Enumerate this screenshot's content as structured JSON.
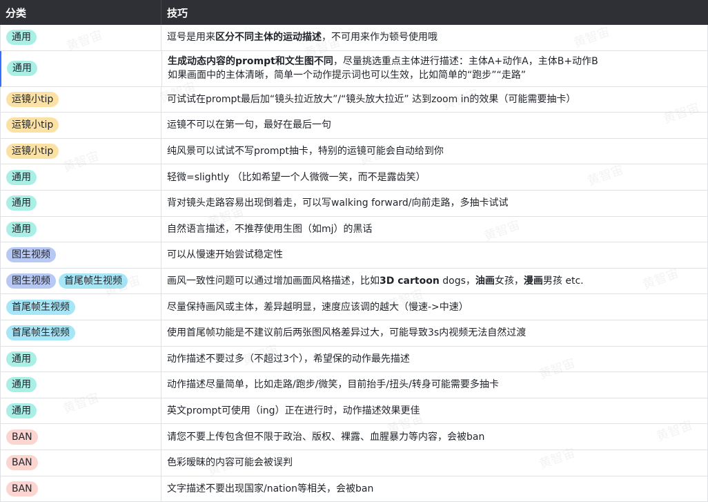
{
  "header": {
    "col_category": "分类",
    "col_tip": "技巧"
  },
  "watermark": "黄智宙",
  "colors": {
    "header_bg": "#2e3035",
    "tag_general": "#a9efe6",
    "tag_camera": "#fbe2a4",
    "tag_img2vid": "#b8c8f5",
    "tag_firstlast": "#a7e6f6",
    "tag_ban": "#fcd4d0"
  },
  "rows": [
    {
      "tags": [
        {
          "label": "通用",
          "kind": "general"
        }
      ],
      "lines": [
        [
          {
            "t": "逗号是用来"
          },
          {
            "t": "区分不同主体的运动描述",
            "b": true
          },
          {
            "t": "，不可用来作为顿号使用哦"
          }
        ]
      ]
    },
    {
      "tall": true,
      "tags": [
        {
          "label": "通用",
          "kind": "general"
        }
      ],
      "lines": [
        [
          {
            "t": "生成动态内容的prompt和文生图不同",
            "b": true
          },
          {
            "t": "，尽量挑选重点主体进行描述：主体A+动作A，主体B+动作B"
          }
        ],
        [
          {
            "t": "如果画面中的主体清晰，简单一个动作提示词也可以生效，比如简单的“跑步”“走路”"
          }
        ]
      ]
    },
    {
      "tags": [
        {
          "label": "运镜小tip",
          "kind": "camera"
        }
      ],
      "lines": [
        [
          {
            "t": "可试试在prompt最后加“镜头拉近放大”/“镜头放大拉近” 达到zoom in的效果（可能需要抽卡）"
          }
        ]
      ]
    },
    {
      "tags": [
        {
          "label": "运镜小tip",
          "kind": "camera"
        }
      ],
      "lines": [
        [
          {
            "t": "运镜不可以在第一句，最好在最后一句"
          }
        ]
      ]
    },
    {
      "tags": [
        {
          "label": "运镜小tip",
          "kind": "camera"
        }
      ],
      "lines": [
        [
          {
            "t": "纯风景可以试试不写prompt抽卡，特别的运镜可能会自动给到你"
          }
        ]
      ]
    },
    {
      "tags": [
        {
          "label": "通用",
          "kind": "general"
        }
      ],
      "lines": [
        [
          {
            "t": "轻微=slightly （比如希望一个人微微一笑，而不是露齿笑）"
          }
        ]
      ]
    },
    {
      "tags": [
        {
          "label": "通用",
          "kind": "general"
        }
      ],
      "lines": [
        [
          {
            "t": "背对镜头走路容易出现倒着走，可以写walking forward/向前走路，多抽卡试试"
          }
        ]
      ]
    },
    {
      "tags": [
        {
          "label": "通用",
          "kind": "general"
        }
      ],
      "lines": [
        [
          {
            "t": "自然语言描述，不推荐使用生图（如mj）的黑话"
          }
        ]
      ]
    },
    {
      "tags": [
        {
          "label": "图生视频",
          "kind": "img2vid"
        }
      ],
      "lines": [
        [
          {
            "t": "可以从慢速开始尝试稳定性"
          }
        ]
      ]
    },
    {
      "tags": [
        {
          "label": "图生视频",
          "kind": "img2vid"
        },
        {
          "label": "首尾帧生视频",
          "kind": "firstlast"
        }
      ],
      "lines": [
        [
          {
            "t": "画风一致性问题可以通过增加画面风格描述，比如"
          },
          {
            "t": "3D cartoon",
            "b": true
          },
          {
            "t": " dogs，"
          },
          {
            "t": "油画",
            "b": true
          },
          {
            "t": "女孩，"
          },
          {
            "t": "漫画",
            "b": true
          },
          {
            "t": "男孩 etc."
          }
        ]
      ]
    },
    {
      "tags": [
        {
          "label": "首尾帧生视频",
          "kind": "firstlast"
        }
      ],
      "lines": [
        [
          {
            "t": "尽量保持画风或主体，差异越明显，速度应该调的越大（慢速->中速）"
          }
        ]
      ]
    },
    {
      "tags": [
        {
          "label": "首尾帧生视频",
          "kind": "firstlast"
        }
      ],
      "lines": [
        [
          {
            "t": "使用首尾帧功能是不建议前后两张图风格差异过大，可能导致3s内视频无法自然过渡"
          }
        ]
      ]
    },
    {
      "tags": [
        {
          "label": "通用",
          "kind": "general"
        }
      ],
      "lines": [
        [
          {
            "t": "动作描述不要过多（不超过3个），希望保的动作最先描述"
          }
        ]
      ]
    },
    {
      "tags": [
        {
          "label": "通用",
          "kind": "general"
        }
      ],
      "lines": [
        [
          {
            "t": "动作描述尽量简单，比如走路/跑步/微笑，目前抬手/扭头/转身可能需要多抽卡"
          }
        ]
      ]
    },
    {
      "tags": [
        {
          "label": "通用",
          "kind": "general"
        }
      ],
      "lines": [
        [
          {
            "t": "英文prompt可使用（ing）正在进行时，动作描述效果更佳"
          }
        ]
      ]
    },
    {
      "tags": [
        {
          "label": "BAN",
          "kind": "ban"
        }
      ],
      "lines": [
        [
          {
            "t": "请您不要上传包含但不限于政治、版权、裸露、血腥暴力等内容，会被ban"
          }
        ]
      ]
    },
    {
      "tags": [
        {
          "label": "BAN",
          "kind": "ban"
        }
      ],
      "lines": [
        [
          {
            "t": "色彩暧昧的内容可能会被误判"
          }
        ]
      ]
    },
    {
      "tags": [
        {
          "label": "BAN",
          "kind": "ban"
        }
      ],
      "lines": [
        [
          {
            "t": "文字描述不要出现国家/nation等相关，会被ban"
          }
        ]
      ]
    }
  ]
}
